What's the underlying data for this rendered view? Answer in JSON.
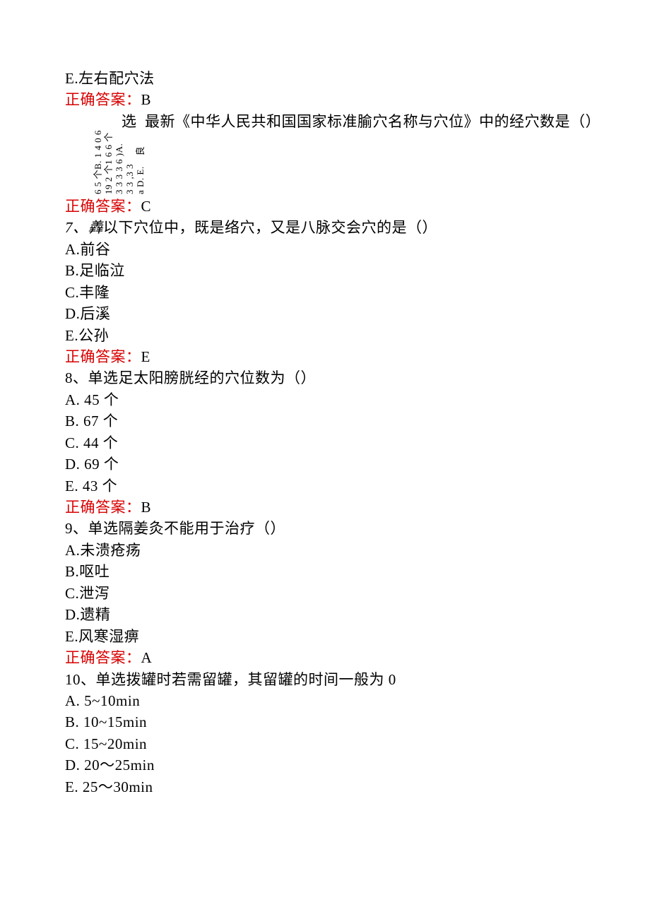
{
  "q5": {
    "optE": "E.左右配穴法",
    "answer_label": "正确答案：",
    "answer_value": "B"
  },
  "q6": {
    "stem_prefix": "选",
    "stem": "最新《中华人民共和国国家标准腧穴名称与穴位》中的经穴数是（）",
    "rotated_block": "6 5 个B. 1 4 0 6\n19 2 个1 6 6 个\n3 3 3 3 6 )A.\n3 3 ,3 3\na D. E.    良",
    "answer_label": "正确答案：",
    "answer_value": "C"
  },
  "q7": {
    "num": "7、",
    "prefix": "羴",
    "stem": "以下穴位中，既是络穴，又是八脉交会穴的是（）",
    "optA": "A.前谷",
    "optB": "B.足临泣",
    "optC": "C.丰隆",
    "optD": "D.后溪",
    "optE": "E.公孙",
    "answer_label": "正确答案：",
    "answer_value": "E"
  },
  "q8": {
    "stem": "8、单选足太阳膀胱经的穴位数为（）",
    "optA": "A. 45 个",
    "optB": "B. 67 个",
    "optC": "C. 44 个",
    "optD": "D. 69 个",
    "optE": "E. 43 个",
    "answer_label": "正确答案：",
    "answer_value": "B"
  },
  "q9": {
    "stem": "9、单选隔姜灸不能用于治疗（）",
    "optA": "A.未溃疮疡",
    "optB": "B.呕吐",
    "optC": "C.泄泻",
    "optD": "D.遗精",
    "optE": "E.风寒湿痹",
    "answer_label": "正确答案：",
    "answer_value": "A"
  },
  "q10": {
    "stem": "10、单选拨罐时若需留罐，其留罐的时间一般为 0",
    "optA": "A. 5~10min",
    "optB": "B. 10~15min",
    "optC": "C. 15~20min",
    "optD": "D. 20～25min",
    "optE": "E. 25～30min"
  }
}
